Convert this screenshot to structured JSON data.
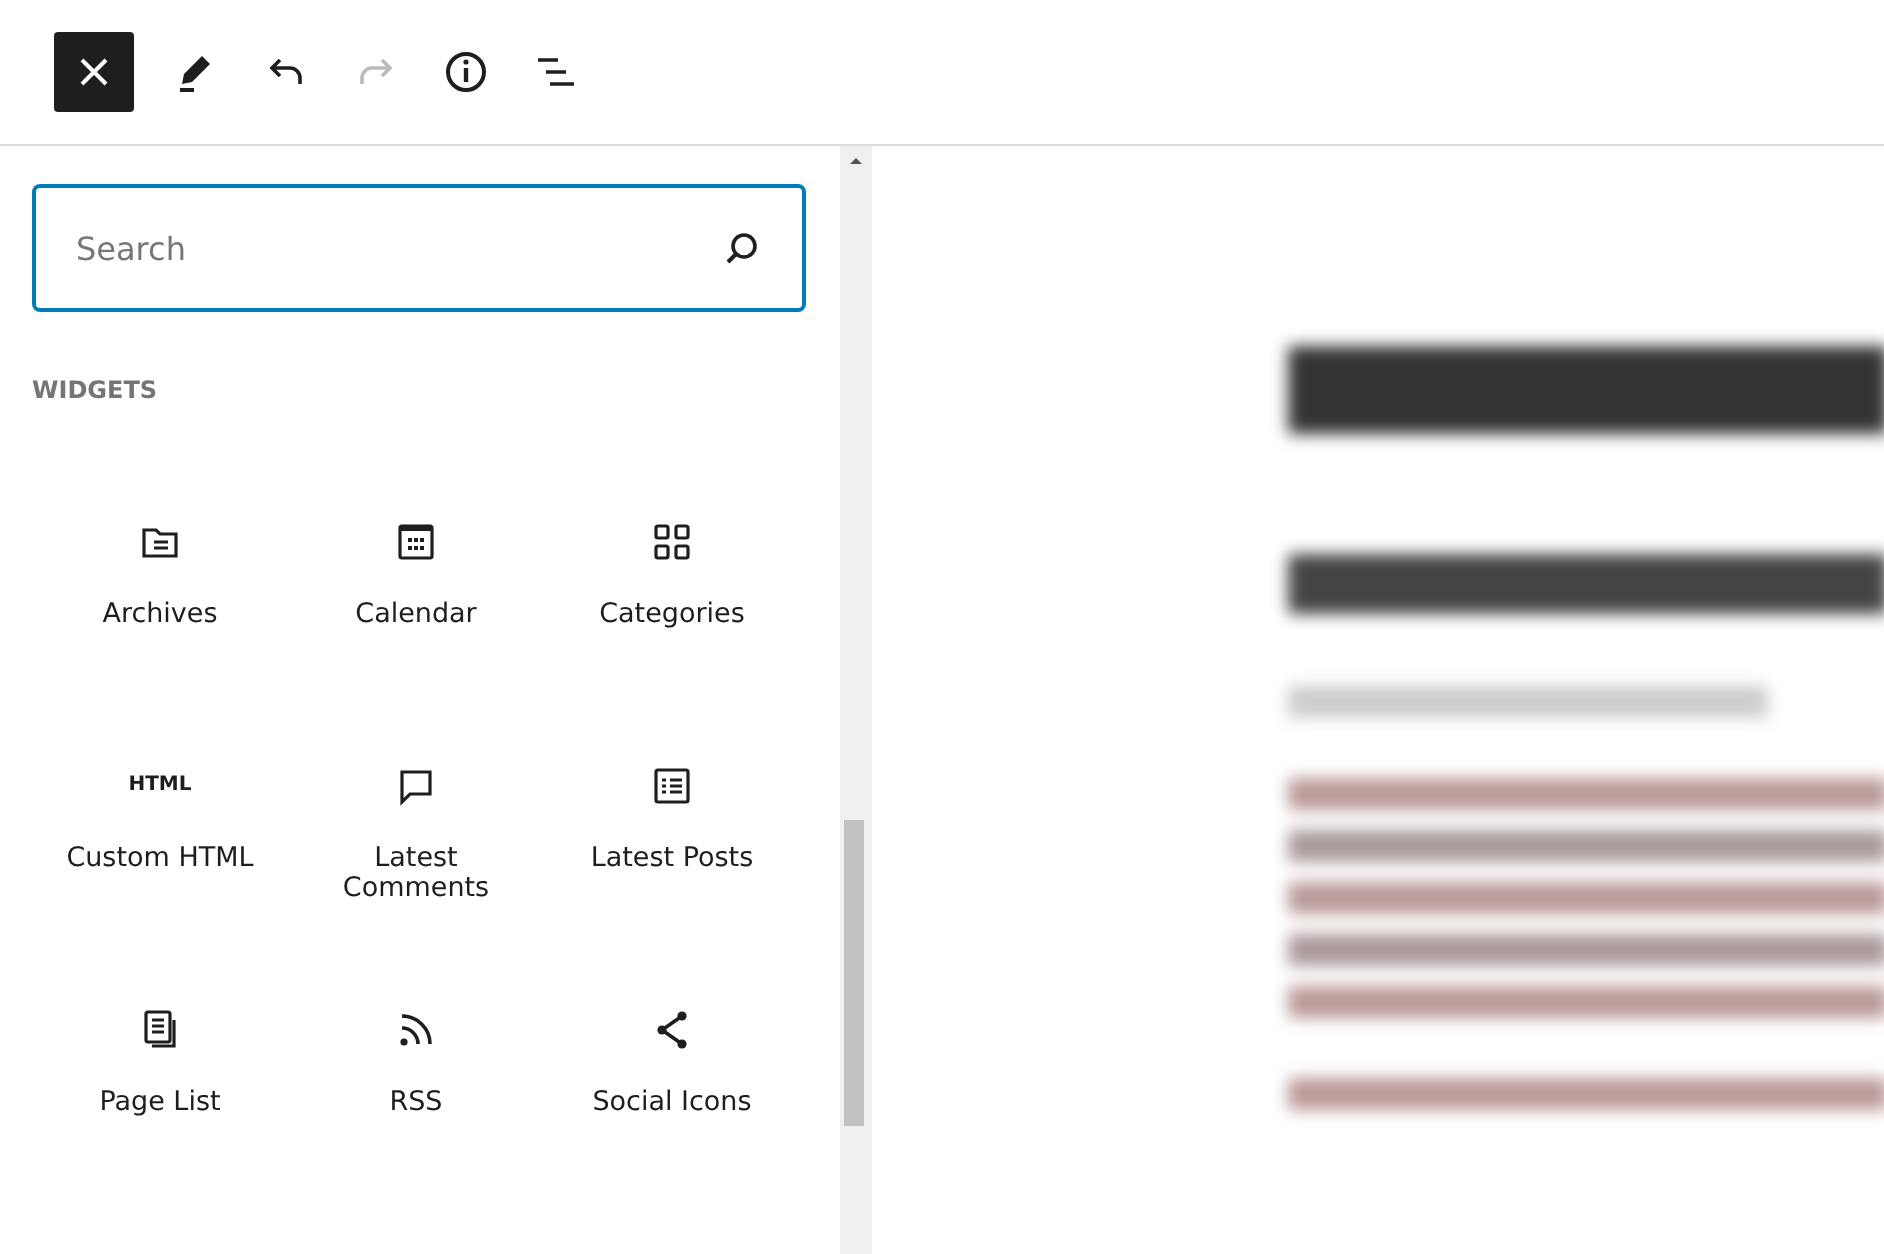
{
  "toolbar": [
    {
      "kind": "close"
    },
    {
      "kind": "edit"
    },
    {
      "kind": "undo",
      "disabled": false
    },
    {
      "kind": "redo",
      "disabled": true
    },
    {
      "kind": "info"
    },
    {
      "kind": "outline"
    }
  ],
  "search": {
    "placeholder": "Search"
  },
  "section_title": "WIDGETS",
  "blocks": [
    {
      "label": "Archives",
      "kind": "archive"
    },
    {
      "label": "Calendar",
      "kind": "calendar"
    },
    {
      "label": "Categories",
      "kind": "categories"
    },
    {
      "label": "Custom HTML",
      "kind": "html",
      "icon_text": "HTML"
    },
    {
      "label": "Latest Comments",
      "kind": "comment"
    },
    {
      "label": "Latest Posts",
      "kind": "posts"
    },
    {
      "label": "Page List",
      "kind": "pages"
    },
    {
      "label": "RSS",
      "kind": "rss"
    },
    {
      "label": "Social Icons",
      "kind": "share"
    }
  ]
}
